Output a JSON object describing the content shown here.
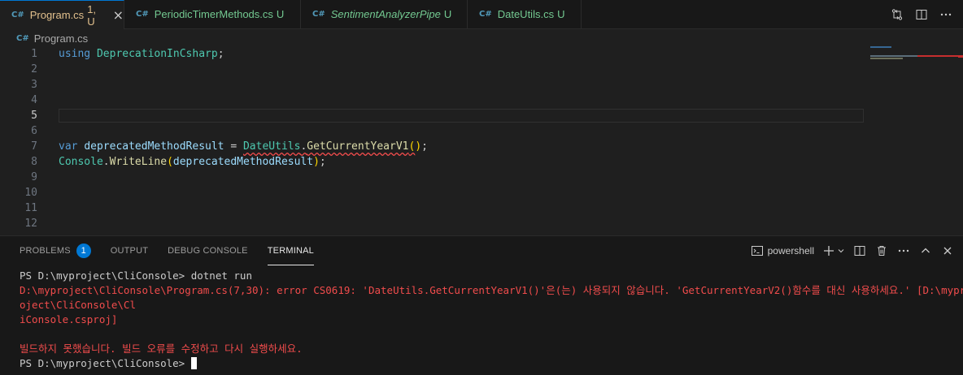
{
  "tabs": [
    {
      "name": "Program.cs",
      "badge": "1, U",
      "active": true
    },
    {
      "name": "PeriodicTimerMethods.cs",
      "badge": "U"
    },
    {
      "name": "SentimentAnalyzerPipe",
      "badge": "U"
    },
    {
      "name": "DateUtils.cs",
      "badge": "U"
    }
  ],
  "breadcrumb": "Program.cs",
  "editor": {
    "line_numbers": [
      "1",
      "2",
      "3",
      "4",
      "5",
      "6",
      "7",
      "8",
      "9",
      "10",
      "11",
      "12"
    ],
    "current_line": "5"
  },
  "code": {
    "l1_kw": "using",
    "l1_ns": "DeprecationInCsharp",
    "l1_end": ";",
    "l7_kw": "var",
    "l7_var": "deprecatedMethodResult",
    "l7_eq": " = ",
    "l7_type": "DateUtils",
    "l7_dot": ".",
    "l7_method": "GetCurrentYearV1",
    "l7_open": "(",
    "l7_close": ")",
    "l7_end": ";",
    "l8_type": "Console",
    "l8_dot": ".",
    "l8_method": "WriteLine",
    "l8_open": "(",
    "l8_arg": "deprecatedMethodResult",
    "l8_close": ")",
    "l8_end": ";"
  },
  "panel": {
    "tabs": {
      "problems": "PROBLEMS",
      "problems_count": "1",
      "output": "OUTPUT",
      "debug": "DEBUG CONSOLE",
      "terminal": "TERMINAL"
    },
    "shell_name": "powershell"
  },
  "terminal": {
    "l1": "PS D:\\myproject\\CliConsole> dotnet run",
    "l2": "D:\\myproject\\CliConsole\\Program.cs(7,30): error CS0619: 'DateUtils.GetCurrentYearV1()'은(는) 사용되지 않습니다. 'GetCurrentYearV2()함수를 대신 사용하세요.' [D:\\mypr",
    "l3": "oject\\CliConsole\\Cl",
    "l4": "iConsole.csproj]",
    "l5": "",
    "l6": "빌드하지 못했습니다. 빌드 오류를 수정하고 다시 실행하세요.",
    "l7": "PS D:\\myproject\\CliConsole> "
  },
  "colors": {
    "accent": "#0078d4",
    "error": "#f14c4c",
    "modified": "#e2c08d",
    "untracked": "#73c991"
  }
}
